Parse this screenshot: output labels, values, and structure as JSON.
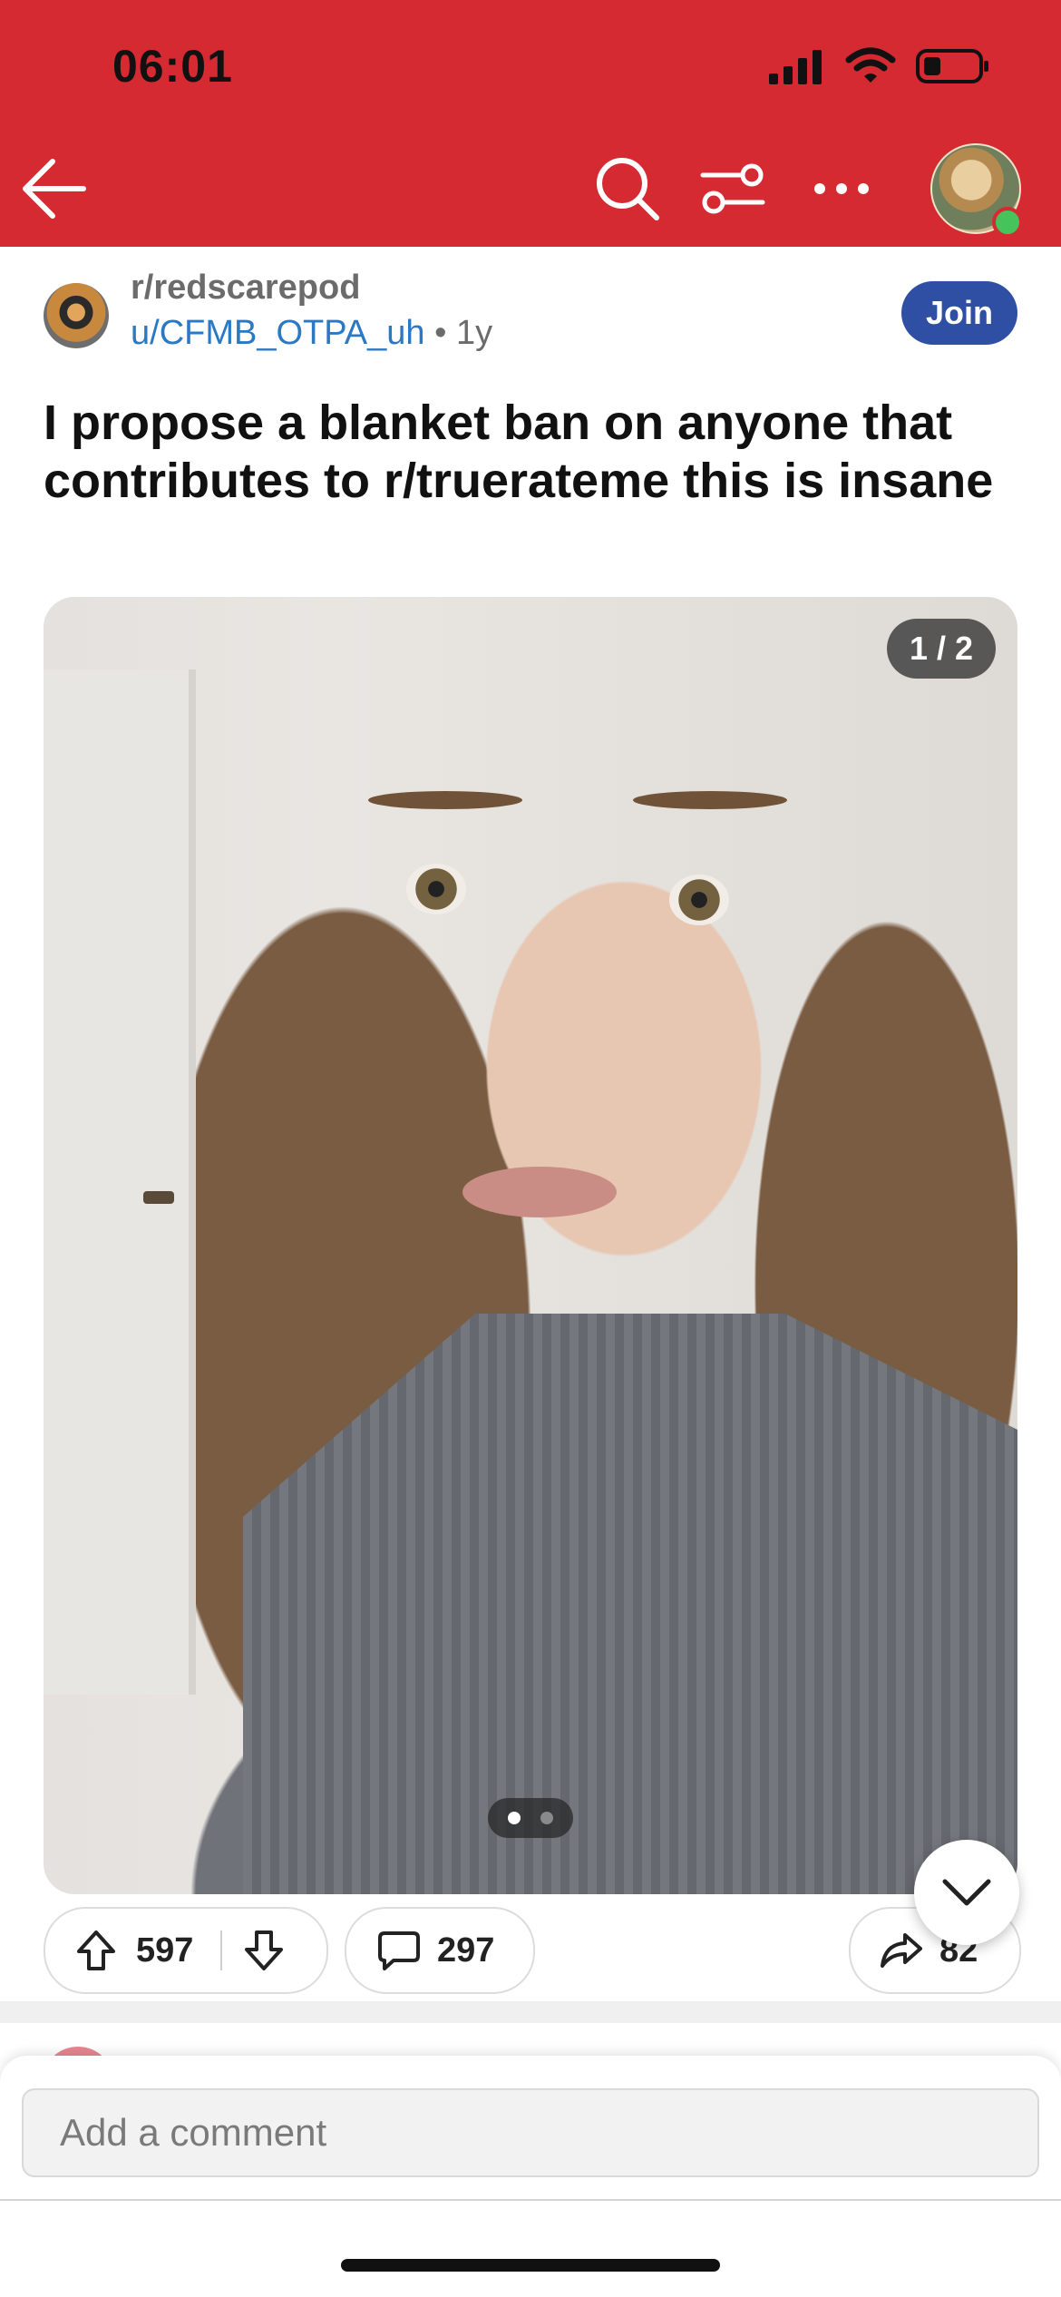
{
  "status_bar": {
    "time": "06:01",
    "battery_color": "#e0262f"
  },
  "toolbar": {
    "back_icon": "arrow-left-icon",
    "search_icon": "search-icon",
    "filter_icon": "sliders-icon",
    "more_icon": "ellipsis-icon",
    "online_color": "#46c35a"
  },
  "post": {
    "subreddit": "r/redscarepod",
    "author": "u/CFMB_OTPA_uh",
    "age": "• 1y",
    "join_label": "Join",
    "title": "I propose a blanket ban on anyone that contributes to r/truerateme this is insane",
    "media": {
      "counter": "1 / 2",
      "current_page": 1,
      "total_pages": 2
    },
    "upvotes": "597",
    "comments": "297",
    "shares": "82"
  },
  "composer": {
    "placeholder": "Add a comment"
  },
  "colors": {
    "brand": "#d62a33",
    "join": "#2e4fa3",
    "link": "#2b78c4"
  }
}
